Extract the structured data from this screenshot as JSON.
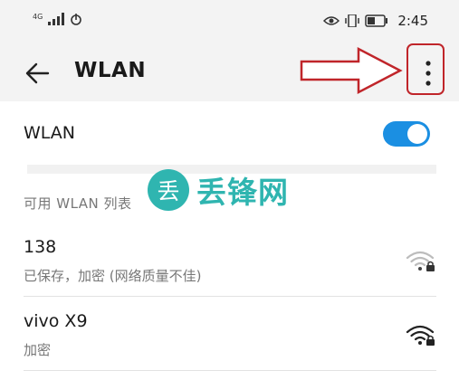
{
  "status_bar": {
    "network_type": "4G",
    "time": "2:45"
  },
  "app_bar": {
    "title": "WLAN"
  },
  "wlan_toggle": {
    "label": "WLAN",
    "state": "on"
  },
  "section": {
    "header": "可用 WLAN 列表"
  },
  "networks": [
    {
      "name": "138",
      "status": "已保存，加密 (网络质量不佳)",
      "signal": "weak",
      "locked": true
    },
    {
      "name": "vivo X9",
      "status": "加密",
      "signal": "strong",
      "locked": true
    }
  ],
  "watermark": {
    "badge": "丢",
    "text": "丢锋网"
  },
  "colors": {
    "accent": "#1b8fe2",
    "annotation_red": "#c0252a",
    "watermark": "#2fb5b0"
  }
}
